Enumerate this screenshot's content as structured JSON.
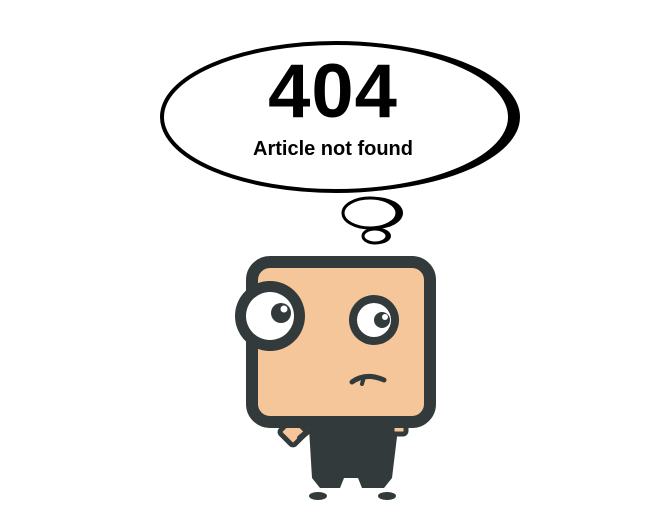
{
  "error": {
    "code": "404",
    "message": "Article not found"
  },
  "illustration": {
    "icon": "confused-character-icon",
    "thought_bubble_icon": "thought-bubble-icon",
    "colors": {
      "outline": "#333a3b",
      "skin": "#f5c69a",
      "eye_white": "#ffffff",
      "text": "#000000"
    }
  }
}
